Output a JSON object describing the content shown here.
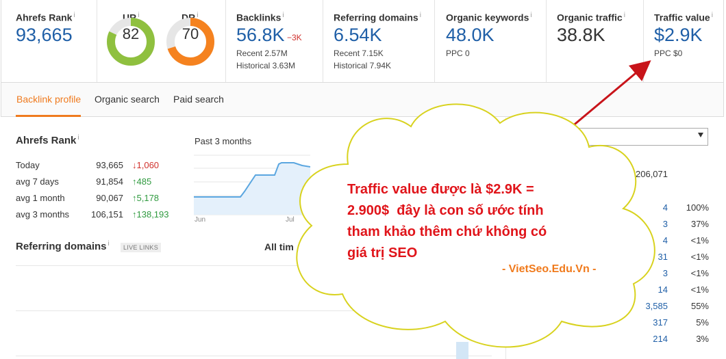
{
  "metrics": {
    "ahrefs_rank": {
      "label": "Ahrefs Rank",
      "value": "93,665"
    },
    "ur": {
      "label": "UR",
      "value": "82",
      "percent": 82,
      "color": "#8fc03f"
    },
    "dr": {
      "label": "DR",
      "value": "70",
      "percent": 70,
      "color": "#f5821f"
    },
    "backlinks": {
      "label": "Backlinks",
      "value": "56.8K",
      "delta": "−3K",
      "recent": "Recent 2.57M",
      "historical": "Historical 3.63M"
    },
    "referring_domains": {
      "label": "Referring domains",
      "value": "6.54K",
      "recent": "Recent 7.15K",
      "historical": "Historical 7.94K"
    },
    "organic_keywords": {
      "label": "Organic keywords",
      "value": "48.0K",
      "ppc": "PPC 0"
    },
    "organic_traffic": {
      "label": "Organic traffic",
      "value": "38.8K"
    },
    "traffic_value": {
      "label": "Traffic value",
      "value": "$2.9K",
      "ppc": "PPC $0"
    }
  },
  "info_mark": "i",
  "tabs": [
    "Backlink profile",
    "Organic search",
    "Paid search"
  ],
  "active_tab": 0,
  "rank_section": {
    "title": "Ahrefs Rank",
    "period": "Past 3 months",
    "rows": [
      {
        "label": "Today",
        "value": "93,665",
        "change": "↓1,060",
        "dir": "down"
      },
      {
        "label": "avg 7 days",
        "value": "91,854",
        "change": "↑485",
        "dir": "up"
      },
      {
        "label": "avg 1 month",
        "value": "90,067",
        "change": "↑5,178",
        "dir": "up"
      },
      {
        "label": "avg 3 months",
        "value": "106,151",
        "change": "↑138,193",
        "dir": "up"
      }
    ],
    "chart_x_labels": [
      "Jun",
      "Jul"
    ]
  },
  "referring_domains_section": {
    "title": "Referring domains",
    "badge": "LIVE LINKS",
    "range": "All tim"
  },
  "right_panel": {
    "top_value": "206,071",
    "rows": [
      {
        "count": "4",
        "pct": "100%"
      },
      {
        "count": "3",
        "pct": "37%"
      },
      {
        "count": "4",
        "pct": "<1%"
      },
      {
        "count": "31",
        "pct": "<1%"
      },
      {
        "count": "3",
        "pct": "<1%"
      },
      {
        "count": "14",
        "pct": "<1%"
      },
      {
        "count": "3,585",
        "pct": "55%"
      },
      {
        "count": "317",
        "pct": "5%"
      },
      {
        "count": "214",
        "pct": "3%"
      }
    ]
  },
  "annotation": {
    "lines": [
      "Traffic value được là $2.9K =",
      "2.900$  đây là con số ước tính",
      "tham khảo thêm chứ không có",
      "giá trị SEO"
    ],
    "brand": "- VietSeo.Edu.Vn -",
    "text_color": "#e0141a",
    "brand_color": "#f07a1c",
    "cloud_fill": "#ffffff",
    "cloud_stroke": "#d8d21e"
  }
}
